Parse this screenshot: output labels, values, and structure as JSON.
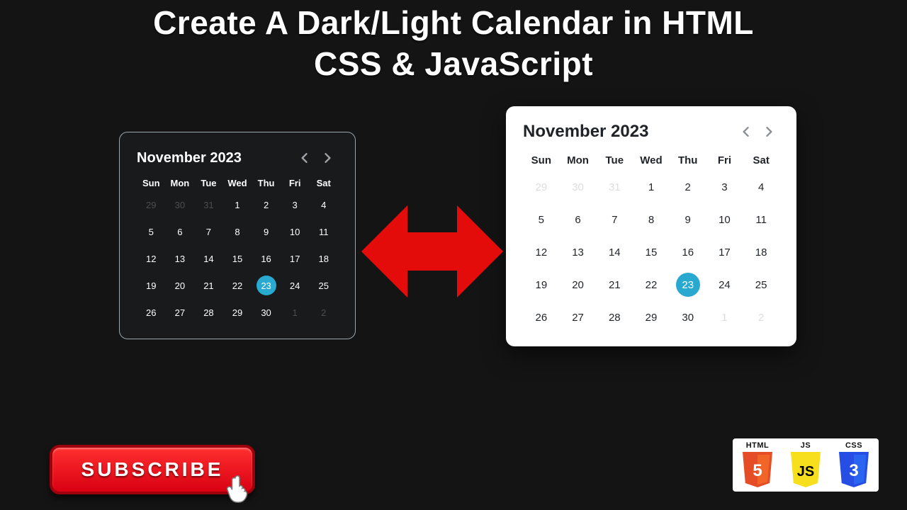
{
  "title": "Create A Dark/Light Calendar in HTML\nCSS & JavaScript",
  "subscribe": {
    "label": "SUBSCRIBE"
  },
  "tech": {
    "html": {
      "label": "HTML",
      "glyph": "5"
    },
    "js": {
      "label": "JS",
      "glyph": "JS"
    },
    "css": {
      "label": "CSS",
      "glyph": "3"
    }
  },
  "calendar": {
    "month_label": "November 2023",
    "weekdays": [
      "Sun",
      "Mon",
      "Tue",
      "Wed",
      "Thu",
      "Fri",
      "Sat"
    ],
    "selected_day": 23,
    "accent": "#29a9d0",
    "cells": [
      {
        "n": 29,
        "muted": true
      },
      {
        "n": 30,
        "muted": true
      },
      {
        "n": 31,
        "muted": true
      },
      {
        "n": 1
      },
      {
        "n": 2
      },
      {
        "n": 3
      },
      {
        "n": 4
      },
      {
        "n": 5
      },
      {
        "n": 6
      },
      {
        "n": 7
      },
      {
        "n": 8
      },
      {
        "n": 9
      },
      {
        "n": 10
      },
      {
        "n": 11
      },
      {
        "n": 12
      },
      {
        "n": 13
      },
      {
        "n": 14
      },
      {
        "n": 15
      },
      {
        "n": 16
      },
      {
        "n": 17
      },
      {
        "n": 18
      },
      {
        "n": 19
      },
      {
        "n": 20
      },
      {
        "n": 21
      },
      {
        "n": 22
      },
      {
        "n": 23,
        "selected": true
      },
      {
        "n": 24
      },
      {
        "n": 25
      },
      {
        "n": 26
      },
      {
        "n": 27
      },
      {
        "n": 28
      },
      {
        "n": 29
      },
      {
        "n": 30
      },
      {
        "n": 1,
        "muted": true
      },
      {
        "n": 2,
        "muted": true
      }
    ]
  }
}
